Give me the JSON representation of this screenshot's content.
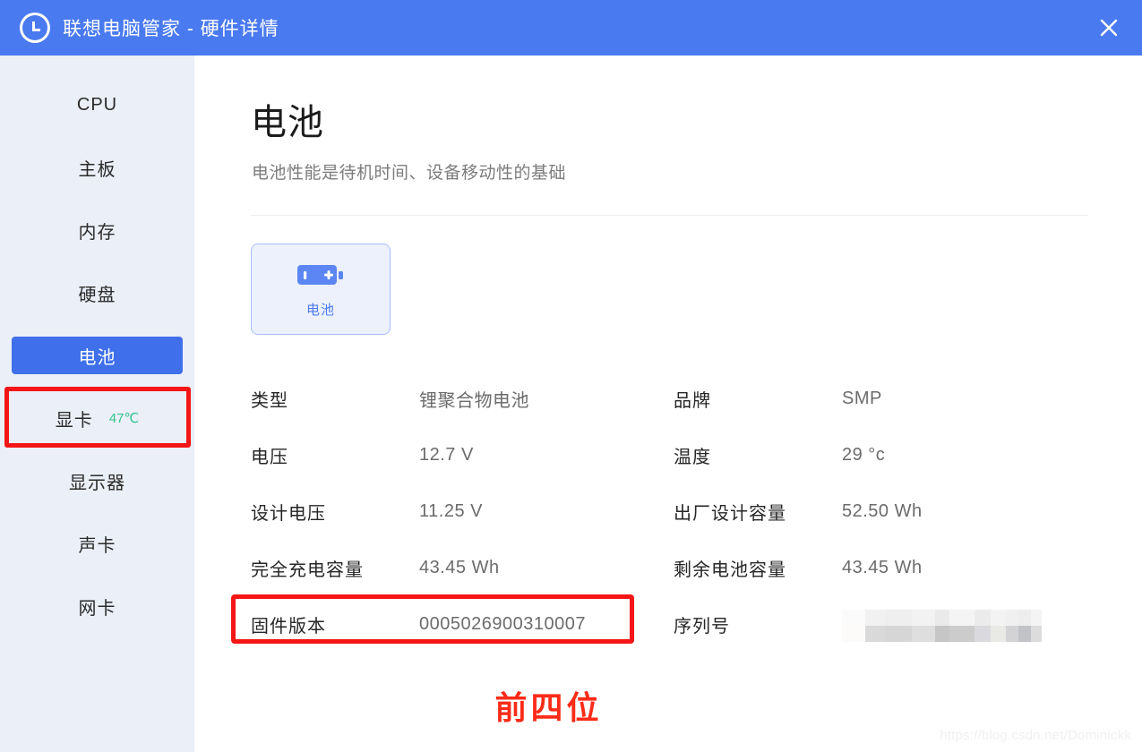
{
  "window": {
    "title": "联想电脑管家 - 硬件详情",
    "logo_icon": "lenovo-circle-logo",
    "close_icon": "close-icon"
  },
  "sidebar": {
    "items": [
      {
        "label": "CPU",
        "selected": false,
        "badge": ""
      },
      {
        "label": "主板",
        "selected": false,
        "badge": ""
      },
      {
        "label": "内存",
        "selected": false,
        "badge": ""
      },
      {
        "label": "硬盘",
        "selected": false,
        "badge": ""
      },
      {
        "label": "电池",
        "selected": true,
        "badge": ""
      },
      {
        "label": "显卡",
        "selected": false,
        "badge": "47℃"
      },
      {
        "label": "显示器",
        "selected": false,
        "badge": ""
      },
      {
        "label": "声卡",
        "selected": false,
        "badge": ""
      },
      {
        "label": "网卡",
        "selected": false,
        "badge": ""
      }
    ]
  },
  "main": {
    "title": "电池",
    "subtitle": "电池性能是待机时间、设备移动性的基础",
    "device_card": {
      "icon": "battery-plus-icon",
      "label": "电池"
    },
    "specs_left": [
      {
        "label": "类型",
        "value": "锂聚合物电池",
        "redacted": false
      },
      {
        "label": "电压",
        "value": "12.7 V",
        "redacted": false
      },
      {
        "label": "设计电压",
        "value": "11.25 V",
        "redacted": false
      },
      {
        "label": "完全充电容量",
        "value": "43.45 Wh",
        "redacted": false
      },
      {
        "label": "固件版本",
        "value": "0005026900310007",
        "redacted": false
      }
    ],
    "specs_right": [
      {
        "label": "品牌",
        "value": "SMP",
        "redacted": false
      },
      {
        "label": "温度",
        "value": "29 °c",
        "redacted": false
      },
      {
        "label": "出厂设计容量",
        "value": "52.50 Wh",
        "redacted": false
      },
      {
        "label": "剩余电池容量",
        "value": "43.45 Wh",
        "redacted": false
      },
      {
        "label": "序列号",
        "value": "",
        "redacted": true
      }
    ]
  },
  "annotations": {
    "bottom_note": "前四位",
    "highlight_color": "#f41616",
    "note_color": "#fc2b18"
  },
  "watermark": "https://blog.csdn.net/Dominickk",
  "colors": {
    "titlebar": "#4a7af0",
    "sidebar": "#ebeff7",
    "selected_item": "#3f6fea",
    "accent": "#4a7af0",
    "temp_badge": "#33c48f",
    "label_text": "#262626",
    "value_text": "#6b6b6b"
  }
}
